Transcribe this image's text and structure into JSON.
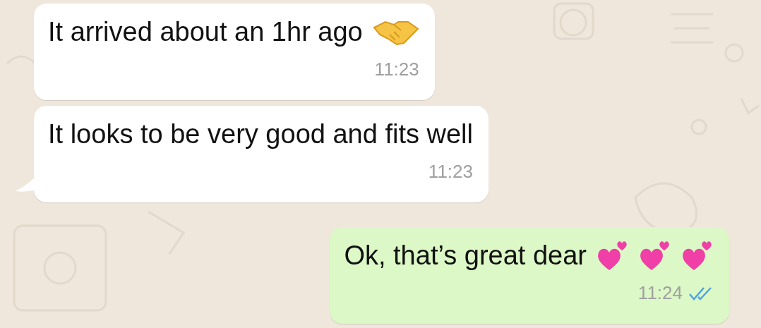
{
  "messages": [
    {
      "kind": "incoming",
      "text": "It arrived about an 1hr ago",
      "time": "11:23",
      "tail": false
    },
    {
      "kind": "incoming",
      "text": "It looks to be very good and fits well",
      "time": "11:23",
      "tail": true
    },
    {
      "kind": "outgoing",
      "text": "Ok, that’s great dear",
      "time": "11:24",
      "tail": false,
      "read": true
    }
  ]
}
